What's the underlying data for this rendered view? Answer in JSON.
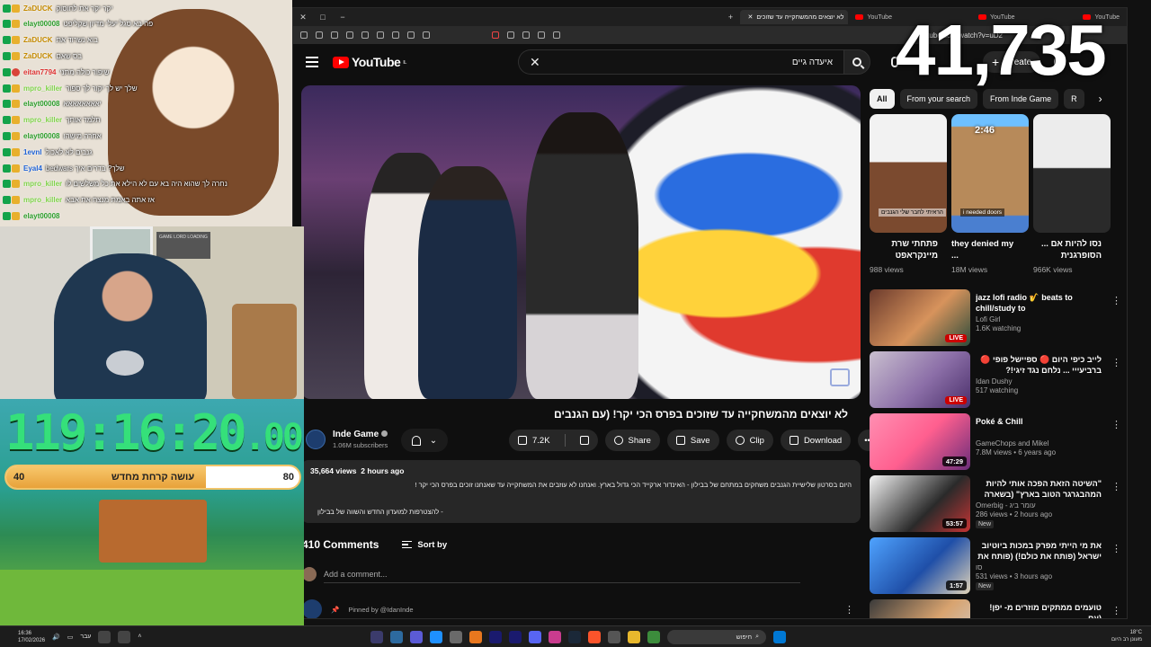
{
  "browser": {
    "tabs": [
      {
        "title": "לא יוצאים מהמשחקייה עד שזוכים"
      },
      {
        "title": "YouTube"
      },
      {
        "title": "YouTube"
      },
      {
        "title": "YouTube"
      }
    ],
    "url": "youtube.com/watch?v=uD2"
  },
  "youtube": {
    "search_query": "איעדה גיים",
    "create_label": "Create",
    "video": {
      "title": "לא יוצאים מהמשחקייה עד שזוכים בפרס הכי יקר! (עם הגנבים",
      "channel_name": "Inde Game",
      "subscribers": "1.06M subscribers",
      "likes": "7.2K",
      "share_label": "Share",
      "save_label": "Save",
      "clip_label": "Clip",
      "download_label": "Download",
      "views": "35,664 views",
      "age": "2 hours ago",
      "description_line1": "היום בסרטון שלישיית הגנבים משחקים במתחם של בבילון - האינדור ארקייד הכי גדול בארץ. ואנחנו לא עוזבים את המשחקייה עד שאנחנו זוכים בפרס הכי יקר !",
      "description_line2": "- להצטרפות למועדון החדש והשווה של בבילון"
    },
    "comments": {
      "count_label": "410 Comments",
      "sort_label": "Sort by",
      "add_placeholder": "Add a comment...",
      "pinned_label": "Pinned by @IdanInde"
    },
    "chips": [
      "All",
      "From your search",
      "From Inde Game",
      "R"
    ],
    "shorts": [
      {
        "title": "פתחתי שרת מיינקראפט",
        "views": "988 views",
        "overlay": "הראיתי לחבר שלי הגנבים"
      },
      {
        "title": "they denied my ...",
        "views": "18M views",
        "overlay": "i needed doors",
        "time": "2:46"
      },
      {
        "title": "נסו להיות אם ... הסופרגנית",
        "views": "966K views",
        "overlay": ""
      }
    ],
    "recommendations": [
      {
        "title": "jazz lofi radio 🎷 beats to chill/study to",
        "channel": "Lofi Girl",
        "meta": "1.6K watching",
        "badge": "LIVE",
        "badge_type": "live",
        "new": ""
      },
      {
        "title": "לייב כיפי היום 🔴 ספיישל פופי 🔴 ברביעייי ... נלחם נגד זיגי!?",
        "channel": "Idan Dushy",
        "meta": "517 watching",
        "badge": "LIVE",
        "badge_type": "live",
        "new": ""
      },
      {
        "title": "Poké & Chill",
        "channel": "GameChops and Mikel",
        "meta": "7.8M views • 6 years ago",
        "badge": "47:29",
        "badge_type": "dur",
        "new": ""
      },
      {
        "title": "\"השיטה הזאת הפכה אותי להיות המהבגרגר הטוב בארץ\" (בשארה ...",
        "channel": "Omerbig - עומר ביג",
        "meta": "286 views • 2 hours ago",
        "badge": "53:57",
        "badge_type": "dur",
        "new": "New"
      },
      {
        "title": "את מי הייתי מפרק במכות ביוטיוב ישראל (פותח את כולם!) (פותח את ...",
        "channel": "סו",
        "meta": "531 views • 3 hours ago",
        "badge": "1:57",
        "badge_type": "dur",
        "new": "New"
      },
      {
        "title": "טועמים ממתקים מוזרים מ- יפן! (עם ...",
        "channel": "",
        "meta": "",
        "badge": "",
        "badge_type": "dur",
        "new": ""
      }
    ]
  },
  "chat": {
    "messages": [
      {
        "user": "ZaDUCK",
        "msg": "יקר יקר את לחוסוק",
        "color": "y"
      },
      {
        "user": "elayt00008",
        "msg": "פה בא סגל יעלי מדיון שקליפט",
        "color": "g"
      },
      {
        "user": "ZaDUCK",
        "msg": "בוא נשרוד את",
        "color": "y"
      },
      {
        "user": "ZaDUCK",
        "msg": "בס שאם",
        "color": "y"
      },
      {
        "user": "eitan7794",
        "msg": "שיפור כולה מתני",
        "color": "r"
      },
      {
        "user": "mpro_killer",
        "msg": "שלך יש לך יקור לך ספור",
        "color": "lg"
      },
      {
        "user": "elayt00008",
        "msg": "יאאאאאאאא",
        "color": "g"
      },
      {
        "user": "mpro_killer",
        "msg": "תלמד אותך",
        "color": "lg"
      },
      {
        "user": "elayt00008",
        "msg": "אחרה מישהו",
        "color": "g"
      },
      {
        "user": "1evnl",
        "msg": "גנבים לא לאכול",
        "color": "b"
      },
      {
        "user": "Eyal4",
        "msg": "שלך? בדרים איך bedwars",
        "color": "b"
      },
      {
        "user": "mpro_killer",
        "msg": "נחרה לך שהוא היה בא עם לא הילא את כל משלשים לו",
        "color": "lg"
      },
      {
        "user": "mpro_killer",
        "msg": "אז אתה באמת מנצח את אבא",
        "color": "lg"
      },
      {
        "user": "elayt00008",
        "msg": "",
        "color": "g"
      }
    ]
  },
  "webcam": {
    "panel_text": "GAME LORD LOADING"
  },
  "stream": {
    "timer_main": "119:16:20",
    "timer_ms": ".00",
    "progress_label": "עושה קרחת מחדש",
    "progress_min": "40",
    "progress_max": "80",
    "progress_fraction": 0.68,
    "counter": "41,735"
  },
  "taskbar": {
    "time": "16:36",
    "date": "17/02/2026",
    "lang": "עבר",
    "search_label": "חיפוש",
    "weather_temp": "18°C",
    "weather_desc": "מעונן רב היום"
  }
}
